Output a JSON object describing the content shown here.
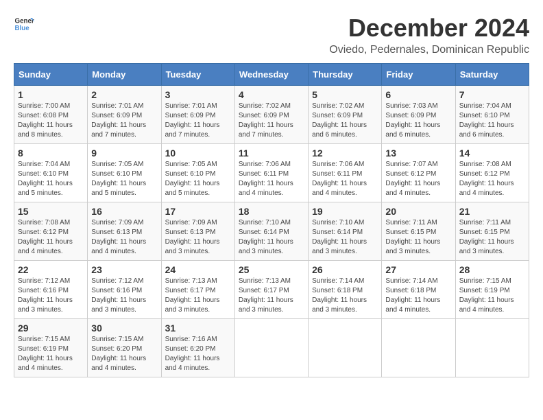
{
  "logo": {
    "general": "General",
    "blue": "Blue"
  },
  "title": "December 2024",
  "location": "Oviedo, Pedernales, Dominican Republic",
  "headers": [
    "Sunday",
    "Monday",
    "Tuesday",
    "Wednesday",
    "Thursday",
    "Friday",
    "Saturday"
  ],
  "weeks": [
    [
      {
        "day": "1",
        "sunrise": "7:00 AM",
        "sunset": "6:08 PM",
        "daylight": "11 hours and 8 minutes."
      },
      {
        "day": "2",
        "sunrise": "7:01 AM",
        "sunset": "6:09 PM",
        "daylight": "11 hours and 7 minutes."
      },
      {
        "day": "3",
        "sunrise": "7:01 AM",
        "sunset": "6:09 PM",
        "daylight": "11 hours and 7 minutes."
      },
      {
        "day": "4",
        "sunrise": "7:02 AM",
        "sunset": "6:09 PM",
        "daylight": "11 hours and 7 minutes."
      },
      {
        "day": "5",
        "sunrise": "7:02 AM",
        "sunset": "6:09 PM",
        "daylight": "11 hours and 6 minutes."
      },
      {
        "day": "6",
        "sunrise": "7:03 AM",
        "sunset": "6:09 PM",
        "daylight": "11 hours and 6 minutes."
      },
      {
        "day": "7",
        "sunrise": "7:04 AM",
        "sunset": "6:10 PM",
        "daylight": "11 hours and 6 minutes."
      }
    ],
    [
      {
        "day": "8",
        "sunrise": "7:04 AM",
        "sunset": "6:10 PM",
        "daylight": "11 hours and 5 minutes."
      },
      {
        "day": "9",
        "sunrise": "7:05 AM",
        "sunset": "6:10 PM",
        "daylight": "11 hours and 5 minutes."
      },
      {
        "day": "10",
        "sunrise": "7:05 AM",
        "sunset": "6:10 PM",
        "daylight": "11 hours and 5 minutes."
      },
      {
        "day": "11",
        "sunrise": "7:06 AM",
        "sunset": "6:11 PM",
        "daylight": "11 hours and 4 minutes."
      },
      {
        "day": "12",
        "sunrise": "7:06 AM",
        "sunset": "6:11 PM",
        "daylight": "11 hours and 4 minutes."
      },
      {
        "day": "13",
        "sunrise": "7:07 AM",
        "sunset": "6:12 PM",
        "daylight": "11 hours and 4 minutes."
      },
      {
        "day": "14",
        "sunrise": "7:08 AM",
        "sunset": "6:12 PM",
        "daylight": "11 hours and 4 minutes."
      }
    ],
    [
      {
        "day": "15",
        "sunrise": "7:08 AM",
        "sunset": "6:12 PM",
        "daylight": "11 hours and 4 minutes."
      },
      {
        "day": "16",
        "sunrise": "7:09 AM",
        "sunset": "6:13 PM",
        "daylight": "11 hours and 4 minutes."
      },
      {
        "day": "17",
        "sunrise": "7:09 AM",
        "sunset": "6:13 PM",
        "daylight": "11 hours and 3 minutes."
      },
      {
        "day": "18",
        "sunrise": "7:10 AM",
        "sunset": "6:14 PM",
        "daylight": "11 hours and 3 minutes."
      },
      {
        "day": "19",
        "sunrise": "7:10 AM",
        "sunset": "6:14 PM",
        "daylight": "11 hours and 3 minutes."
      },
      {
        "day": "20",
        "sunrise": "7:11 AM",
        "sunset": "6:15 PM",
        "daylight": "11 hours and 3 minutes."
      },
      {
        "day": "21",
        "sunrise": "7:11 AM",
        "sunset": "6:15 PM",
        "daylight": "11 hours and 3 minutes."
      }
    ],
    [
      {
        "day": "22",
        "sunrise": "7:12 AM",
        "sunset": "6:16 PM",
        "daylight": "11 hours and 3 minutes."
      },
      {
        "day": "23",
        "sunrise": "7:12 AM",
        "sunset": "6:16 PM",
        "daylight": "11 hours and 3 minutes."
      },
      {
        "day": "24",
        "sunrise": "7:13 AM",
        "sunset": "6:17 PM",
        "daylight": "11 hours and 3 minutes."
      },
      {
        "day": "25",
        "sunrise": "7:13 AM",
        "sunset": "6:17 PM",
        "daylight": "11 hours and 3 minutes."
      },
      {
        "day": "26",
        "sunrise": "7:14 AM",
        "sunset": "6:18 PM",
        "daylight": "11 hours and 3 minutes."
      },
      {
        "day": "27",
        "sunrise": "7:14 AM",
        "sunset": "6:18 PM",
        "daylight": "11 hours and 4 minutes."
      },
      {
        "day": "28",
        "sunrise": "7:15 AM",
        "sunset": "6:19 PM",
        "daylight": "11 hours and 4 minutes."
      }
    ],
    [
      {
        "day": "29",
        "sunrise": "7:15 AM",
        "sunset": "6:19 PM",
        "daylight": "11 hours and 4 minutes."
      },
      {
        "day": "30",
        "sunrise": "7:15 AM",
        "sunset": "6:20 PM",
        "daylight": "11 hours and 4 minutes."
      },
      {
        "day": "31",
        "sunrise": "7:16 AM",
        "sunset": "6:20 PM",
        "daylight": "11 hours and 4 minutes."
      },
      null,
      null,
      null,
      null
    ]
  ]
}
